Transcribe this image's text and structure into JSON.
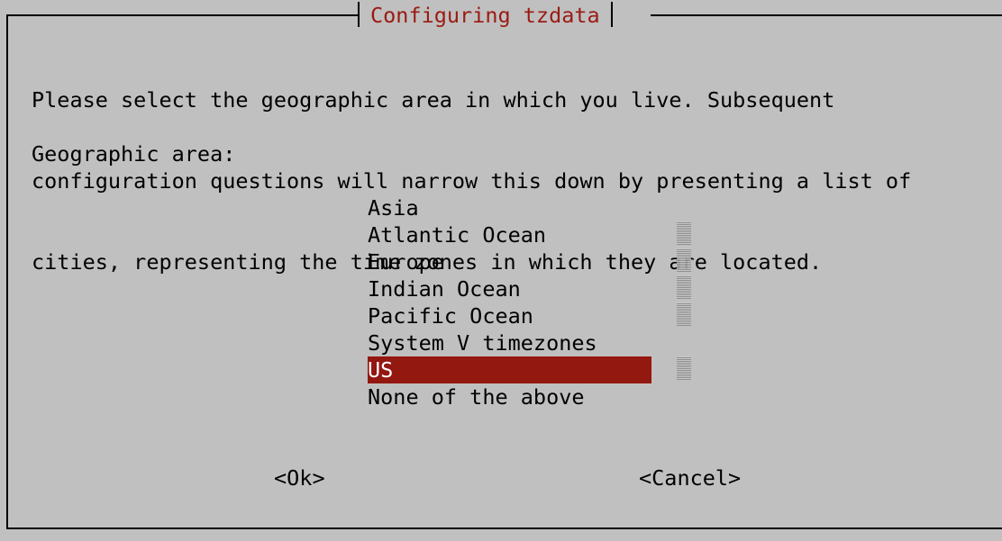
{
  "dialog": {
    "title": "Configuring tzdata",
    "prose_lines": [
      "Please select the geographic area in which you live. Subsequent",
      "configuration questions will narrow this down by presenting a list of",
      "cities, representing the time zones in which they are located."
    ],
    "area_label": "Geographic area:",
    "menu": {
      "items": [
        {
          "label": "Asia",
          "selected": false
        },
        {
          "label": "Atlantic Ocean",
          "selected": false
        },
        {
          "label": "Europe",
          "selected": false
        },
        {
          "label": "Indian Ocean",
          "selected": false
        },
        {
          "label": "Pacific Ocean",
          "selected": false
        },
        {
          "label": "System V timezones",
          "selected": false
        },
        {
          "label": "US",
          "selected": true
        },
        {
          "label": "None of the above",
          "selected": false
        }
      ],
      "selected_color": "#931810"
    },
    "buttons": {
      "ok_label": "<Ok>",
      "cancel_label": "<Cancel>"
    },
    "colors": {
      "background": "#c0c0c0",
      "title": "#9a1b13",
      "text": "#000000"
    }
  }
}
